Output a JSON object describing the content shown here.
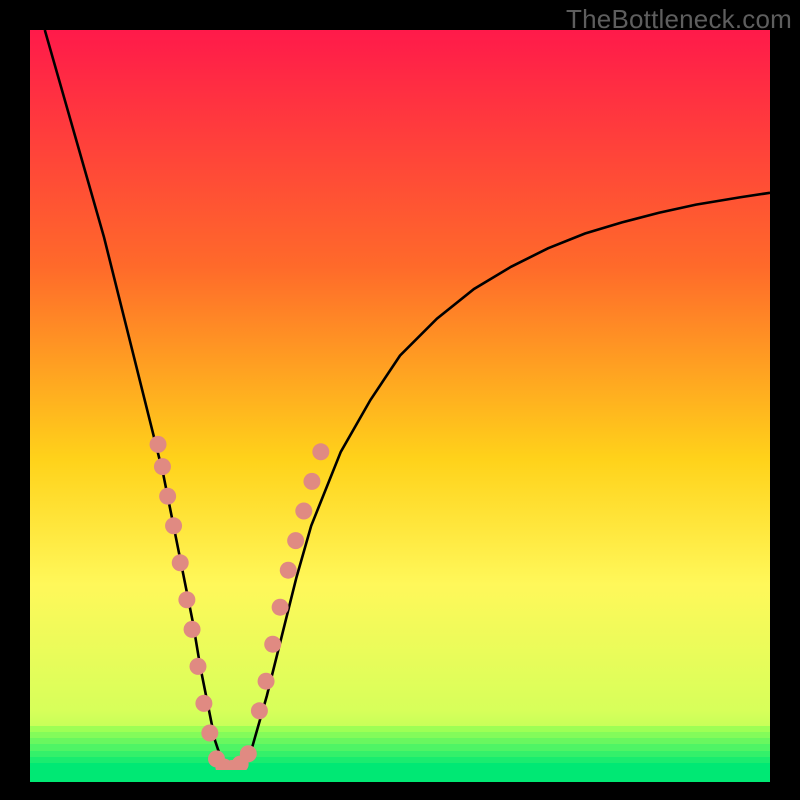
{
  "watermark": "TheBottleneck.com",
  "colors": {
    "frame": "#000000",
    "gradient_top": "#ff1a4a",
    "gradient_mid1": "#ff6a2a",
    "gradient_mid2": "#ffd21a",
    "gradient_mid3": "#fff85a",
    "gradient_bottom": "#d7ff5a",
    "green_band_start": "#9dff55",
    "green_band_end": "#00e874",
    "curve": "#000000",
    "dots": "#e08a82"
  },
  "chart_data": {
    "type": "line",
    "title": "",
    "xlabel": "",
    "ylabel": "",
    "xlim": [
      0,
      100
    ],
    "ylim": [
      0,
      100
    ],
    "series": [
      {
        "name": "bottleneck-curve",
        "x": [
          2,
          4,
          6,
          8,
          10,
          12,
          14,
          16,
          18,
          20,
          22,
          23,
          24,
          25,
          26,
          27,
          28,
          30,
          32,
          34,
          36,
          38,
          42,
          46,
          50,
          55,
          60,
          65,
          70,
          75,
          80,
          85,
          90,
          96,
          100
        ],
        "y": [
          100,
          93,
          86,
          79,
          72,
          64,
          56,
          48,
          40,
          30,
          20,
          14,
          9,
          4,
          1,
          0,
          0,
          3,
          10,
          18,
          26,
          33,
          43,
          50,
          56,
          61,
          65,
          68,
          70.5,
          72.5,
          74,
          75.3,
          76.4,
          77.4,
          78
        ]
      }
    ],
    "scatter_groups": [
      {
        "name": "left-arm-dots",
        "points": [
          {
            "x": 17.3,
            "y": 44
          },
          {
            "x": 17.9,
            "y": 41
          },
          {
            "x": 18.6,
            "y": 37
          },
          {
            "x": 19.4,
            "y": 33
          },
          {
            "x": 20.3,
            "y": 28
          },
          {
            "x": 21.2,
            "y": 23
          },
          {
            "x": 21.9,
            "y": 19
          },
          {
            "x": 22.7,
            "y": 14
          },
          {
            "x": 23.5,
            "y": 9
          },
          {
            "x": 24.3,
            "y": 5
          }
        ]
      },
      {
        "name": "valley-dots",
        "points": [
          {
            "x": 25.2,
            "y": 1.5
          },
          {
            "x": 26.2,
            "y": 0.4
          },
          {
            "x": 27.3,
            "y": 0.2
          },
          {
            "x": 28.4,
            "y": 0.8
          },
          {
            "x": 29.5,
            "y": 2.2
          }
        ]
      },
      {
        "name": "right-arm-dots",
        "points": [
          {
            "x": 31.0,
            "y": 8
          },
          {
            "x": 31.9,
            "y": 12
          },
          {
            "x": 32.8,
            "y": 17
          },
          {
            "x": 33.8,
            "y": 22
          },
          {
            "x": 34.9,
            "y": 27
          },
          {
            "x": 35.9,
            "y": 31
          },
          {
            "x": 37.0,
            "y": 35
          },
          {
            "x": 38.1,
            "y": 39
          },
          {
            "x": 39.3,
            "y": 43
          }
        ]
      }
    ],
    "green_band": {
      "from_y": 0,
      "to_y": 6
    }
  }
}
